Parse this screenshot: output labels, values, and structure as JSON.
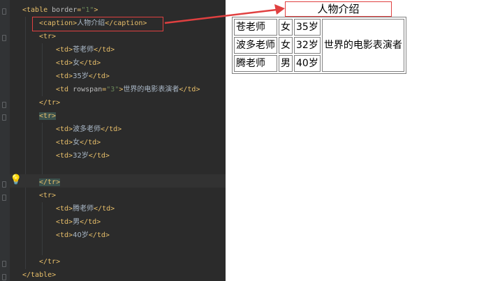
{
  "editor": {
    "lines": [
      {
        "indent": 0,
        "segments": [
          {
            "c": "tag",
            "t": "<table "
          },
          {
            "c": "attr",
            "t": "border"
          },
          {
            "c": "tag",
            "t": "="
          },
          {
            "c": "val",
            "t": "\"1\""
          },
          {
            "c": "tag",
            "t": ">"
          }
        ]
      },
      {
        "indent": 1,
        "segments": [
          {
            "c": "tag",
            "t": "<caption>"
          },
          {
            "c": "txt",
            "t": "人物介绍"
          },
          {
            "c": "tag",
            "t": "</caption>"
          }
        ]
      },
      {
        "indent": 1,
        "segments": [
          {
            "c": "tag",
            "t": "<tr>"
          }
        ]
      },
      {
        "indent": 2,
        "segments": [
          {
            "c": "tag",
            "t": "<td>"
          },
          {
            "c": "txt",
            "t": "苍老师"
          },
          {
            "c": "tag",
            "t": "</td>"
          }
        ]
      },
      {
        "indent": 2,
        "segments": [
          {
            "c": "tag",
            "t": "<td>"
          },
          {
            "c": "txt",
            "t": "女"
          },
          {
            "c": "tag",
            "t": "</td>"
          }
        ]
      },
      {
        "indent": 2,
        "segments": [
          {
            "c": "tag",
            "t": "<td>"
          },
          {
            "c": "txt",
            "t": "35岁"
          },
          {
            "c": "tag",
            "t": "</td>"
          }
        ]
      },
      {
        "indent": 2,
        "segments": [
          {
            "c": "tag",
            "t": "<td "
          },
          {
            "c": "attr",
            "t": "rowspan"
          },
          {
            "c": "tag",
            "t": "="
          },
          {
            "c": "val",
            "t": "\"3\""
          },
          {
            "c": "tag",
            "t": ">"
          },
          {
            "c": "txt",
            "t": "世界的电影表演者"
          },
          {
            "c": "tag",
            "t": "</td>"
          }
        ]
      },
      {
        "indent": 1,
        "segments": [
          {
            "c": "tag",
            "t": "</tr>"
          }
        ]
      },
      {
        "indent": 1,
        "segments": [
          {
            "c": "tag match",
            "t": "<tr>"
          }
        ]
      },
      {
        "indent": 2,
        "segments": [
          {
            "c": "tag",
            "t": "<td>"
          },
          {
            "c": "txt",
            "t": "波多老师"
          },
          {
            "c": "tag",
            "t": "</td>"
          }
        ]
      },
      {
        "indent": 2,
        "segments": [
          {
            "c": "tag",
            "t": "<td>"
          },
          {
            "c": "txt",
            "t": "女"
          },
          {
            "c": "tag",
            "t": "</td>"
          }
        ]
      },
      {
        "indent": 2,
        "segments": [
          {
            "c": "tag",
            "t": "<td>"
          },
          {
            "c": "txt",
            "t": "32岁"
          },
          {
            "c": "tag",
            "t": "</td>"
          }
        ]
      },
      {
        "indent": 0,
        "segments": []
      },
      {
        "indent": 1,
        "segments": [
          {
            "c": "tag match",
            "t": "</tr>"
          }
        ]
      },
      {
        "indent": 1,
        "segments": [
          {
            "c": "tag",
            "t": "<tr>"
          }
        ]
      },
      {
        "indent": 2,
        "segments": [
          {
            "c": "tag",
            "t": "<td>"
          },
          {
            "c": "txt",
            "t": "腾老师"
          },
          {
            "c": "tag",
            "t": "</td>"
          }
        ]
      },
      {
        "indent": 2,
        "segments": [
          {
            "c": "tag",
            "t": "<td>"
          },
          {
            "c": "txt",
            "t": "男"
          },
          {
            "c": "tag",
            "t": "</td>"
          }
        ]
      },
      {
        "indent": 2,
        "segments": [
          {
            "c": "tag",
            "t": "<td>"
          },
          {
            "c": "txt",
            "t": "40岁"
          },
          {
            "c": "tag",
            "t": "</td>"
          }
        ]
      },
      {
        "indent": 0,
        "segments": []
      },
      {
        "indent": 1,
        "segments": [
          {
            "c": "tag",
            "t": "</tr>"
          }
        ]
      },
      {
        "indent": 0,
        "segments": [
          {
            "c": "tag",
            "t": "</table>"
          }
        ]
      }
    ],
    "bulb_icon": "lightbulb-icon"
  },
  "preview": {
    "caption": "人物介绍",
    "rows": [
      [
        "苍老师",
        "女",
        "35岁"
      ],
      [
        "波多老师",
        "女",
        "32岁"
      ],
      [
        "腾老师",
        "男",
        "40岁"
      ]
    ],
    "rowspan_cell": "世界的电影表演者"
  },
  "colors": {
    "editor_bg": "#2b2b2b",
    "tag": "#e8bf6a",
    "attr_value": "#6a8759",
    "annotation_red": "#e04040"
  }
}
